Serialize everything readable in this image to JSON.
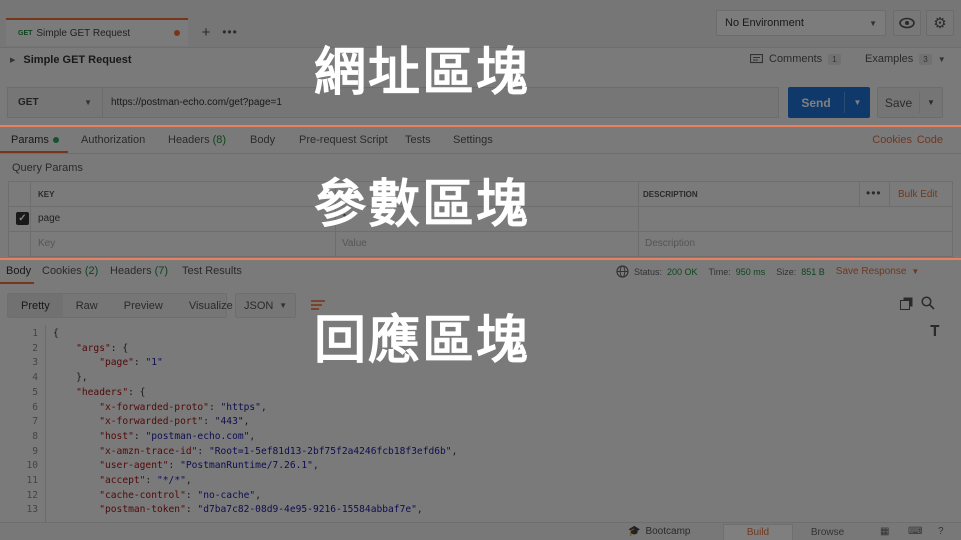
{
  "request_tab": {
    "method": "GET",
    "title": "Simple GET Request"
  },
  "environment": {
    "selected": "No Environment"
  },
  "request": {
    "name": "Simple GET Request",
    "comments_label": "Comments",
    "comments_count": "1",
    "examples_label": "Examples",
    "examples_count": "3",
    "method": "GET",
    "url": "https://postman-echo.com/get?page=1",
    "send_label": "Send",
    "save_label": "Save"
  },
  "request_tabs": {
    "params": "Params",
    "authorization": "Authorization",
    "headers": "Headers",
    "headers_count": "(8)",
    "body": "Body",
    "prerequest": "Pre-request Script",
    "tests": "Tests",
    "settings": "Settings",
    "cookies": "Cookies",
    "code": "Code"
  },
  "query_params": {
    "title": "Query Params",
    "col_key": "KEY",
    "col_description": "DESCRIPTION",
    "bulk_edit": "Bulk Edit",
    "row": {
      "key": "page",
      "value": "1",
      "description": ""
    },
    "placeholder_key": "Key",
    "placeholder_value": "Value",
    "placeholder_description": "Description"
  },
  "response_tabs": {
    "body": "Body",
    "cookies": "Cookies",
    "cookies_count": "(2)",
    "headers": "Headers",
    "headers_count": "(7)",
    "test_results": "Test Results"
  },
  "response_status": {
    "status_label": "Status:",
    "status_value": "200 OK",
    "time_label": "Time:",
    "time_value": "950 ms",
    "size_label": "Size:",
    "size_value": "851 B",
    "save_response": "Save Response"
  },
  "response_view": {
    "pretty": "Pretty",
    "raw": "Raw",
    "preview": "Preview",
    "visualize": "Visualize",
    "format": "JSON"
  },
  "response_lines": [
    {
      "n": "1",
      "t": "{"
    },
    {
      "n": "2",
      "t": "    \"args\": {"
    },
    {
      "n": "3",
      "t": "        \"page\": \"1\""
    },
    {
      "n": "4",
      "t": "    },"
    },
    {
      "n": "5",
      "t": "    \"headers\": {"
    },
    {
      "n": "6",
      "t": "        \"x-forwarded-proto\": \"https\","
    },
    {
      "n": "7",
      "t": "        \"x-forwarded-port\": \"443\","
    },
    {
      "n": "8",
      "t": "        \"host\": \"postman-echo.com\","
    },
    {
      "n": "9",
      "t": "        \"x-amzn-trace-id\": \"Root=1-5ef81d13-2bf75f2a4246fcb18f3efd6b\","
    },
    {
      "n": "10",
      "t": "        \"user-agent\": \"PostmanRuntime/7.26.1\","
    },
    {
      "n": "11",
      "t": "        \"accept\": \"*/*\","
    },
    {
      "n": "12",
      "t": "        \"cache-control\": \"no-cache\","
    },
    {
      "n": "13",
      "t": "        \"postman-token\": \"d7ba7c82-08d9-4e95-9216-15584abbaf7e\","
    }
  ],
  "status_bar": {
    "bootcamp": "Bootcamp",
    "build": "Build",
    "browse": "Browse"
  },
  "annotations": {
    "url_region": "網址區塊",
    "params_region": "參數區塊",
    "response_region": "回應區塊"
  },
  "colors": {
    "accent": "#ef6c36",
    "send": "#1f72d6",
    "success": "#1d8a3e",
    "divider": "#e9805f"
  }
}
